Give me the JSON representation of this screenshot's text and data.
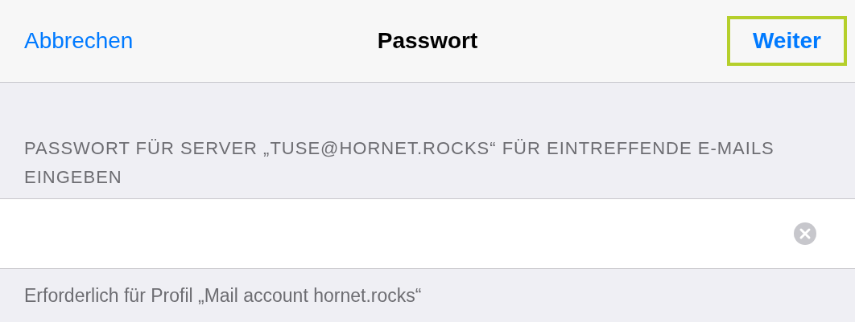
{
  "nav": {
    "cancel": "Abbrechen",
    "title": "Passwort",
    "next": {
      "label": "Weiter",
      "highlighted": true
    }
  },
  "section_header": "PASSWORT FÜR SERVER „TUSE@HORNET.ROCKS“ FÜR EINTREFFENDE E-MAILS EINGEBEN",
  "footer": "Erforderlich für Profil „Mail account hornet.rocks“"
}
